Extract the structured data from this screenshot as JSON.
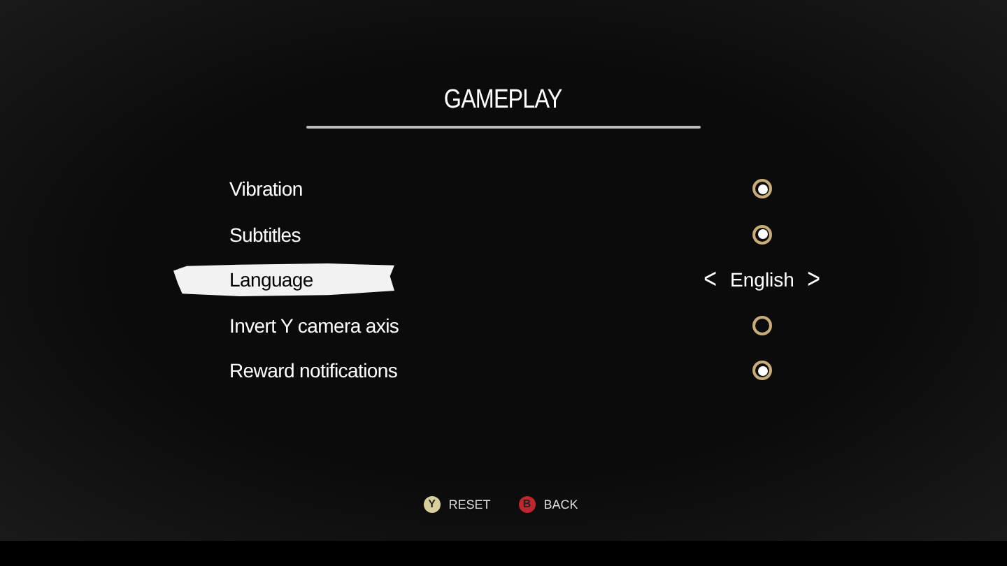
{
  "title": "GAMEPLAY",
  "settings": [
    {
      "label": "Vibration",
      "kind": "toggle",
      "checked": true,
      "selected": false
    },
    {
      "label": "Subtitles",
      "kind": "toggle",
      "checked": true,
      "selected": false
    },
    {
      "label": "Language",
      "kind": "selector",
      "value": "English",
      "prev": "<",
      "next": ">",
      "selected": true
    },
    {
      "label": "Invert Y camera axis",
      "kind": "toggle",
      "checked": false,
      "selected": false
    },
    {
      "label": "Reward notifications",
      "kind": "toggle",
      "checked": true,
      "selected": false
    }
  ],
  "hints": [
    {
      "key": "Y",
      "label": "RESET",
      "color": "#d8cf9a"
    },
    {
      "key": "B",
      "label": "BACK",
      "color": "#c0262c"
    }
  ]
}
